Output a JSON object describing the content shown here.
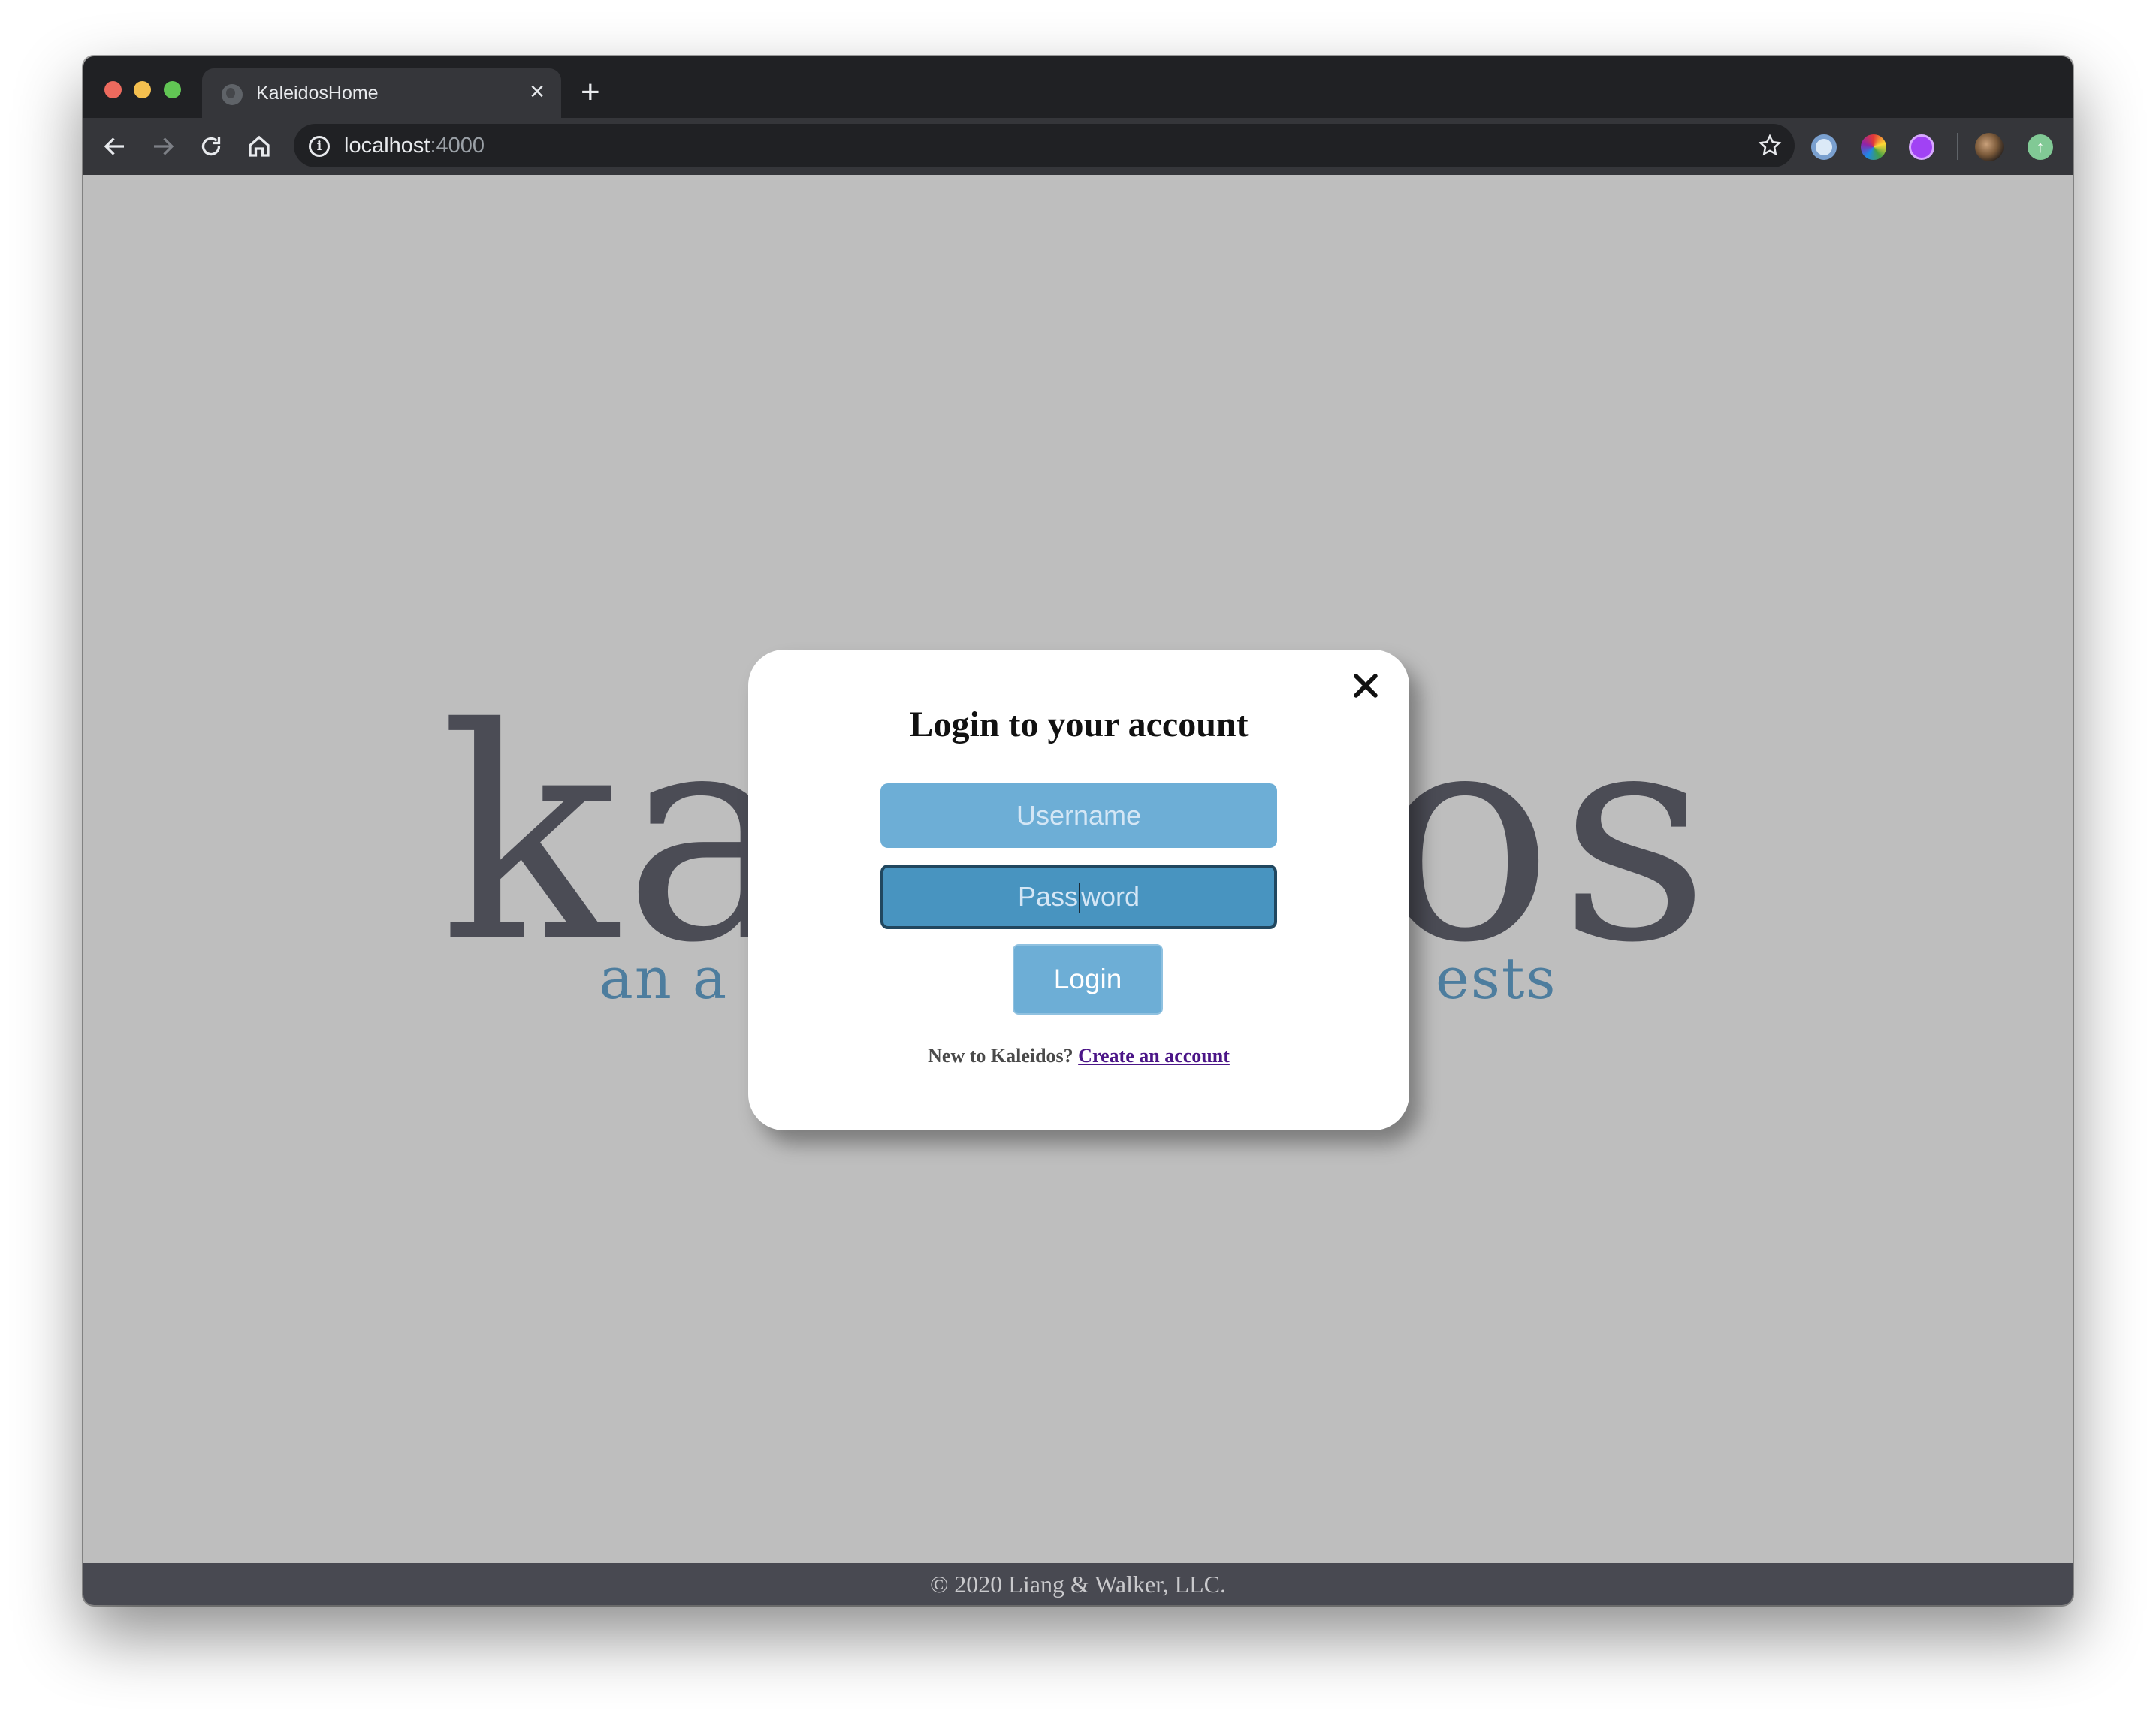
{
  "browser": {
    "tab_title": "KaleidosHome",
    "url_host": "localhost",
    "url_port": ":4000"
  },
  "page": {
    "hero_title": "kaleidos",
    "hero_subtitle": "an a                                    ests",
    "footer": "© 2020 Liang & Walker, LLC."
  },
  "modal": {
    "title": "Login to your account",
    "username_placeholder": "Username",
    "password_placeholder_before_caret": "Pass",
    "password_placeholder_after_caret": "word",
    "login_label": "Login",
    "signup_prompt": "New to Kaleidos? ",
    "signup_link": "Create an account"
  },
  "colors": {
    "page_bg": "#bebebe",
    "accent": "#6daed6",
    "accent_active": "#4894c0",
    "footer_bg": "#484951"
  },
  "icons": [
    "globe-icon",
    "close-icon",
    "plus-icon",
    "back-icon",
    "forward-icon",
    "reload-icon",
    "home-icon",
    "info-icon",
    "star-icon"
  ]
}
